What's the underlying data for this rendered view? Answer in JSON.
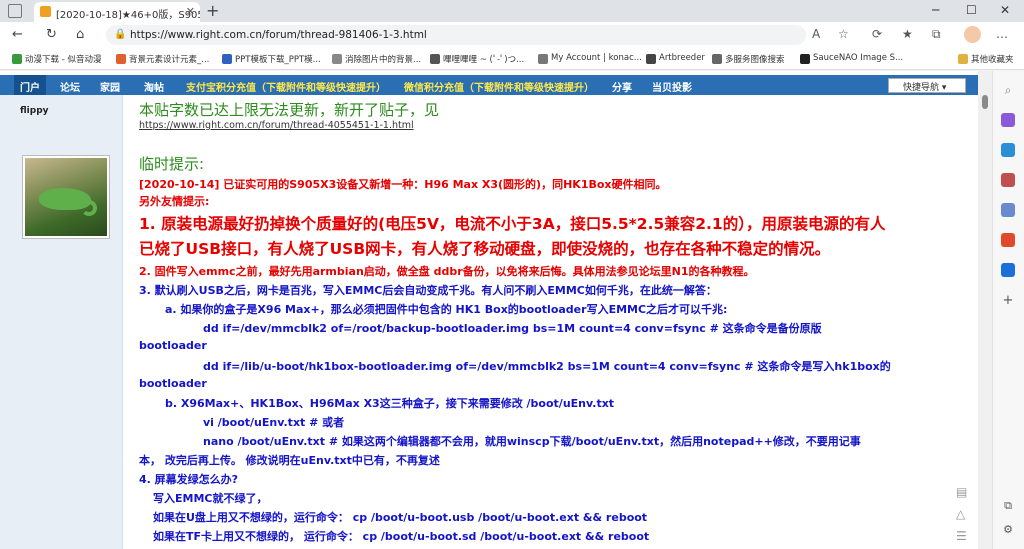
{
  "browser": {
    "tab_title": "[2020-10-18]★46+0版，S905x3",
    "url": "https://www.right.com.cn/forum/thread-981406-1-3.html",
    "bookmarks": [
      {
        "label": "动漫下载 - 似音动漫",
        "color": "#3a9a3a"
      },
      {
        "label": "背景元素设计元素_...",
        "color": "#e06030"
      },
      {
        "label": "PPT模板下载_PPT模...",
        "color": "#3060c0"
      },
      {
        "label": "消除图片中的背景...",
        "color": "#888888"
      },
      {
        "label": "嗶哩嗶哩 ~ (ﾟ-ﾟ)つ...",
        "color": "#555555"
      },
      {
        "label": "My Account | konac...",
        "color": "#777777"
      },
      {
        "label": "Artbreeder",
        "color": "#444444"
      },
      {
        "label": "多服务图像搜索",
        "color": "#666666"
      },
      {
        "label": "SauceNAO Image S...",
        "color": "#222222"
      },
      {
        "label": "其他收藏夹",
        "color": "#e0b040"
      }
    ]
  },
  "forum_nav": {
    "items": [
      "门户",
      "论坛",
      "家园",
      "淘帖"
    ],
    "promo1": "支付宝积分充值（下载附件和等级快速提升）",
    "promo2": "微信积分充值（下载附件和等级快速提升）",
    "share": "分享",
    "ad": "当贝投影",
    "quick_nav": "快捷导航"
  },
  "post": {
    "author": "flippy",
    "headline": "本贴字数已达上限无法更新，新开了贴子，见",
    "new_thread_link": "https://www.right.com.cn/forum/thread-4055451-1-1.html",
    "tip_heading": "临时提示:",
    "tip_date_line": "[2020-10-14] 已证实可用的S905X3设备又新增一种：H96 Max X3(圆形的)，同HK1Box硬件相同。",
    "extra_tip": "另外友情提示:",
    "note1_a": "1. 原装电源最好扔掉换个质量好的(电压5V，电流不小于3A，接口5.5*2.5兼容2.1的），用原装电源的有人",
    "note1_b": "已烧了USB接口，有人烧了USB网卡，有人烧了移动硬盘，即使没烧的，也存在各种不稳定的情况。",
    "note2": "2. 固件写入emmc之前，最好先用armbian启动，做全盘 ddbr备份，以免将来后悔。具体用法参见论坛里N1的各种教程。",
    "note3": "3. 默认刷入USB之后，网卡是百兆，写入EMMC后会自动变成千兆。有人问不刷入EMMC如何千兆，在此统一解答：",
    "note3a": "a. 如果你的盒子是X96 Max+，那么必须把固件中包含的 HK1 Box的bootloader写入EMMC之后才可以千兆:",
    "cmd1_a": "dd   if=/dev/mmcblk2   of=/root/backup-bootloader.img    bs=1M   count=4   conv=fsync     # 这条命令是备份原版",
    "cmd1_b": "bootloader",
    "cmd2_a": "dd   if=/lib/u-boot/hk1box-bootloader.img  of=/dev/mmcblk2 bs=1M count=4 conv=fsync   # 这条命令是写入hk1box的",
    "cmd2_b": "bootloader",
    "note3b": "b. X96Max+、HK1Box、H96Max X3这三种盒子，接下来需要修改 /boot/uEnv.txt",
    "cmd3": "vi   /boot/uEnv.txt   # 或者",
    "cmd4_a": "nano   /boot/uEnv.txt     # 如果这两个编辑器都不会用，就用winscp下载/boot/uEnv.txt，然后用notepad++修改，不要用记事",
    "cmd4_b": "本，  改完后再上传。 修改说明在uEnv.txt中已有，不再复述",
    "note4": "4. 屏幕发绿怎么办?",
    "note4_a": "写入EMMC就不绿了，",
    "note4_b": "如果在U盘上用又不想绿的，运行命令：  cp   /boot/u-boot.usb   /boot/u-boot.ext   &&   reboot",
    "note4_c": "如果在TF卡上用又不想绿的，  运行命令：  cp   /boot/u-boot.sd   /boot/u-boot.ext  && reboot"
  }
}
